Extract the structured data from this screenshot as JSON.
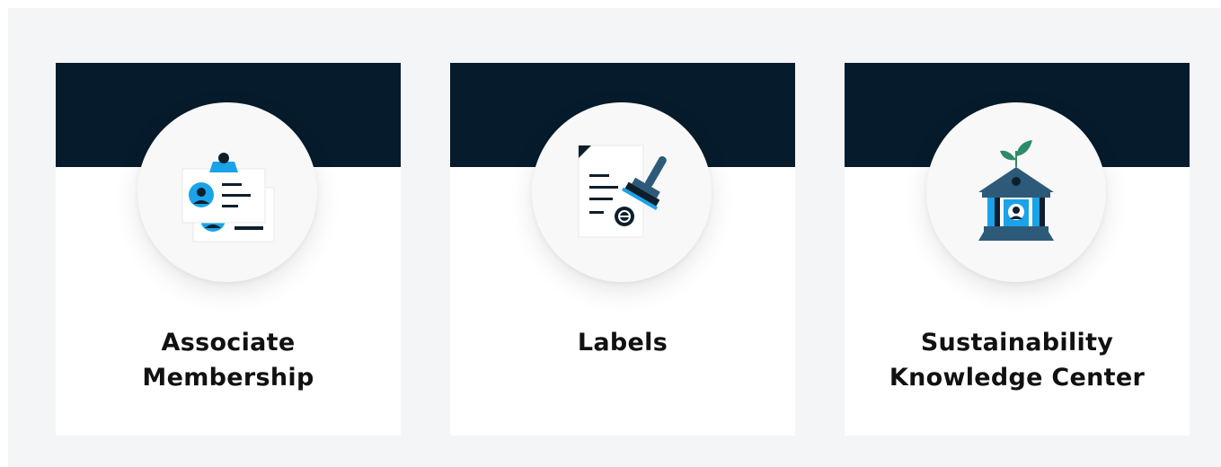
{
  "colors": {
    "page_background": "#f4f5f7",
    "card_band": "#061c2c",
    "card_background": "#ffffff",
    "icon_accent_blue": "#1aa3e8",
    "icon_dark_navy": "#0d1f2d",
    "icon_slate_blue": "#2e5a7a",
    "icon_leaf_green": "#2e8b6a"
  },
  "cards": [
    {
      "icon": "membership-cards-icon",
      "title_lines": [
        "Associate",
        "Membership"
      ]
    },
    {
      "icon": "certificate-stamp-icon",
      "title_lines": [
        "Labels"
      ]
    },
    {
      "icon": "knowledge-building-icon",
      "title_lines": [
        "Sustainability",
        "Knowledge Center"
      ]
    }
  ]
}
